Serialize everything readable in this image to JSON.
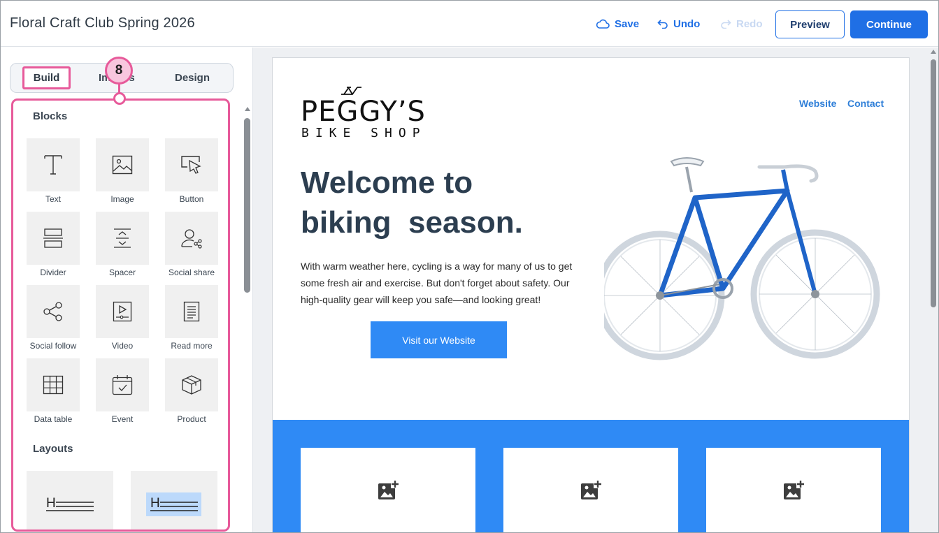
{
  "header": {
    "title": "Floral Craft Club Spring 2026",
    "save_label": "Save",
    "undo_label": "Undo",
    "redo_label": "Redo",
    "preview_label": "Preview",
    "continue_label": "Continue"
  },
  "left_panel": {
    "tabs": [
      {
        "label": "Build",
        "selected": true
      },
      {
        "label": "Images",
        "selected": false
      },
      {
        "label": "Design",
        "selected": false
      }
    ],
    "callout_number": "8",
    "blocks_heading": "Blocks",
    "blocks": [
      {
        "label": "Text",
        "icon": "text-icon"
      },
      {
        "label": "Image",
        "icon": "image-icon"
      },
      {
        "label": "Button",
        "icon": "button-cursor-icon"
      },
      {
        "label": "Divider",
        "icon": "divider-icon"
      },
      {
        "label": "Spacer",
        "icon": "spacer-icon"
      },
      {
        "label": "Social share",
        "icon": "social-share-icon"
      },
      {
        "label": "Social follow",
        "icon": "share-nodes-icon"
      },
      {
        "label": "Video",
        "icon": "video-icon"
      },
      {
        "label": "Read more",
        "icon": "document-icon"
      },
      {
        "label": "Data table",
        "icon": "grid-icon"
      },
      {
        "label": "Event",
        "icon": "calendar-check-icon"
      },
      {
        "label": "Product",
        "icon": "box-icon"
      }
    ],
    "layouts_heading": "Layouts",
    "layouts": [
      {
        "letter": "H",
        "highlighted": false
      },
      {
        "letter": "H",
        "highlighted": true
      }
    ]
  },
  "email": {
    "logo_main": "PEGGY’S",
    "logo_sub": "BIKE SHOP",
    "nav": [
      "Website",
      "Contact"
    ],
    "headline_line1": "Welcome to",
    "headline_line2": "biking  season.",
    "body": "With warm weather here, cycling is a way for many of us to get some fresh air and exercise. But don't forget about safety. Our high-quality gear will keep you safe—and looking great!",
    "cta_label": "Visit our Website",
    "accent_color": "#2f8af5",
    "image_placeholders": 3
  },
  "colors": {
    "primary": "#1f6fe5",
    "highlight": "#e75a9a"
  }
}
